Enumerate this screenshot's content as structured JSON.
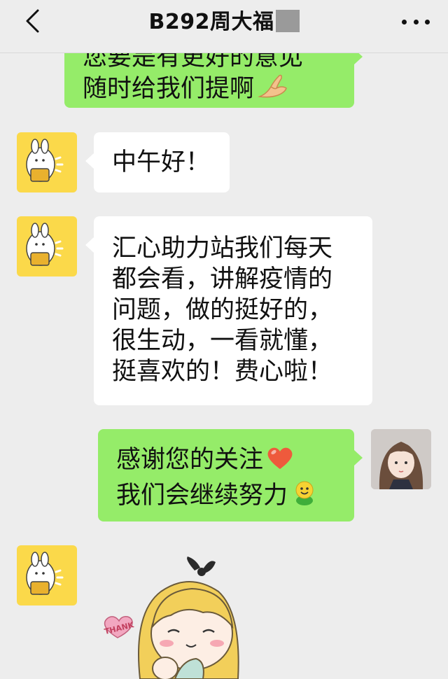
{
  "header": {
    "title": "B292周大福",
    "back_icon": "chevron-left-icon",
    "more_icon": "more-dots-icon"
  },
  "messages": [
    {
      "sender": "me",
      "lines": [
        "您要是有更好的意见",
        "随时给我们提啊"
      ],
      "emoji": "hands-bow-icon"
    },
    {
      "sender": "contact",
      "lines": [
        "中午好！"
      ]
    },
    {
      "sender": "contact",
      "lines": [
        "汇心助力站我们每天",
        "都会看，讲解疫情的",
        "问题，做的挺好的，",
        "很生动，一看就懂，",
        "挺喜欢的！费心啦！"
      ]
    },
    {
      "sender": "me",
      "lines": [
        "感谢您的关注",
        "我们会继续努力"
      ],
      "emojis": [
        "heart-icon",
        "smiley-face-icon"
      ]
    },
    {
      "sender": "contact",
      "sticker": "cartoon-girl-thank-sticker",
      "sticker_text": "THANK"
    }
  ],
  "colors": {
    "background": "#ededed",
    "outgoing_bubble": "#95ec69",
    "incoming_bubble": "#ffffff",
    "contact_avatar": "#fbd94a"
  }
}
